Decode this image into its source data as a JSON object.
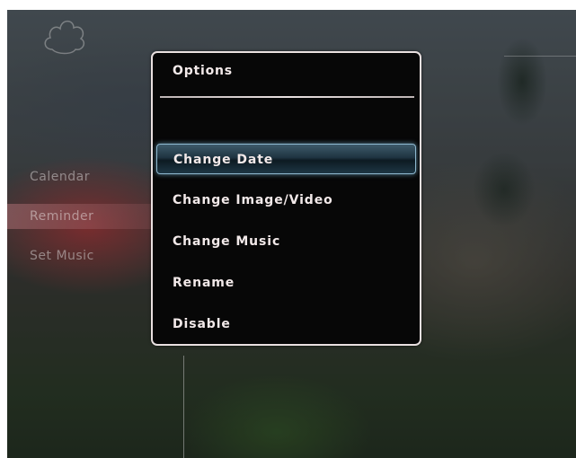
{
  "side_menu": {
    "items": [
      {
        "label": "Calendar"
      },
      {
        "label": "Reminder"
      },
      {
        "label": "Set Music"
      }
    ]
  },
  "dialog": {
    "title": "Options",
    "items": [
      {
        "label": "Change Date"
      },
      {
        "label": "Change Image/Video"
      },
      {
        "label": "Change Music"
      },
      {
        "label": "Rename"
      },
      {
        "label": "Disable"
      }
    ]
  },
  "colors": {
    "highlight_border": "#8fb9d0",
    "dialog_border": "#e9e0e0",
    "dialog_background": "#070707"
  },
  "icons": {
    "top_left": "cloud-icon"
  }
}
